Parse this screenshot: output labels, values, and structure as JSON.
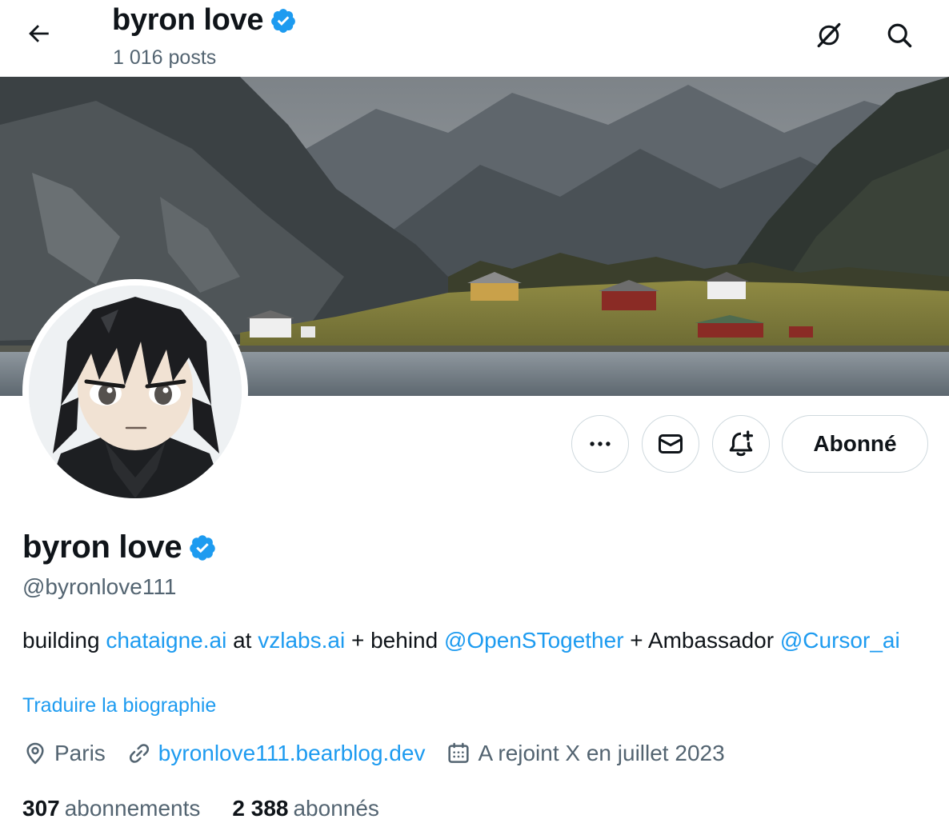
{
  "header": {
    "display_name": "byron love",
    "posts_count": "1 016 posts"
  },
  "actions": {
    "follow_label": "Abonné"
  },
  "profile": {
    "display_name": "byron love",
    "handle": "@byronlove111",
    "bio": {
      "t1": "building ",
      "l1": "chataigne.ai",
      "t2": " at ",
      "l2": "vzlabs.ai",
      "t3": " + behind ",
      "l3": "@OpenSTogether",
      "t4": " + Ambassador ",
      "l4": "@Cursor_ai"
    },
    "translate_label": "Traduire la biographie",
    "location": "Paris",
    "website": "byronlove111.bearblog.dev",
    "joined": "A rejoint X en juillet 2023",
    "following_count": "307",
    "following_label": "abonnements",
    "followers_count": "2 388",
    "followers_label": "abonnés"
  },
  "colors": {
    "accent": "#1d9bf0",
    "text": "#0f1419",
    "secondary": "#536471",
    "border": "#cfd9de"
  },
  "icons": [
    "back-arrow-icon",
    "verified-badge-icon",
    "grok-icon",
    "search-icon",
    "more-icon",
    "message-icon",
    "notification-bell-icon",
    "location-icon",
    "link-icon",
    "calendar-icon"
  ]
}
